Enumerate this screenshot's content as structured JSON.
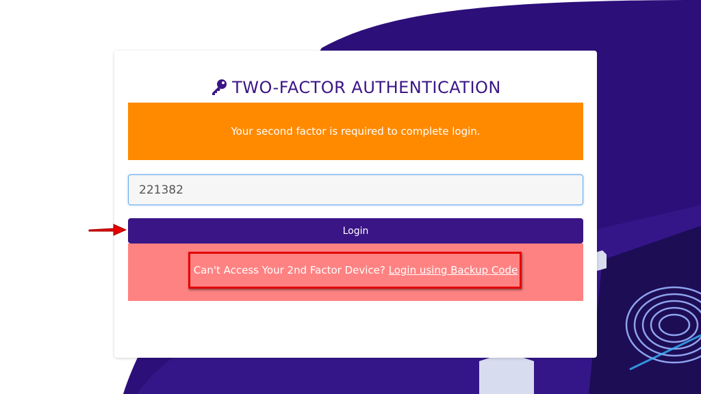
{
  "header": {
    "title": "TWO-FACTOR AUTHENTICATION",
    "icon": "key-icon"
  },
  "alert": {
    "message": "Your second factor is required to complete login."
  },
  "form": {
    "code_value": "221382",
    "login_label": "Login"
  },
  "backup": {
    "prompt": "Can't Access Your 2nd Factor Device?",
    "link": "Login using Backup Code"
  },
  "colors": {
    "brand": "#3a1585",
    "warning": "#ff8a00",
    "backup_bg": "#ff8282",
    "highlight": "#e30000"
  }
}
